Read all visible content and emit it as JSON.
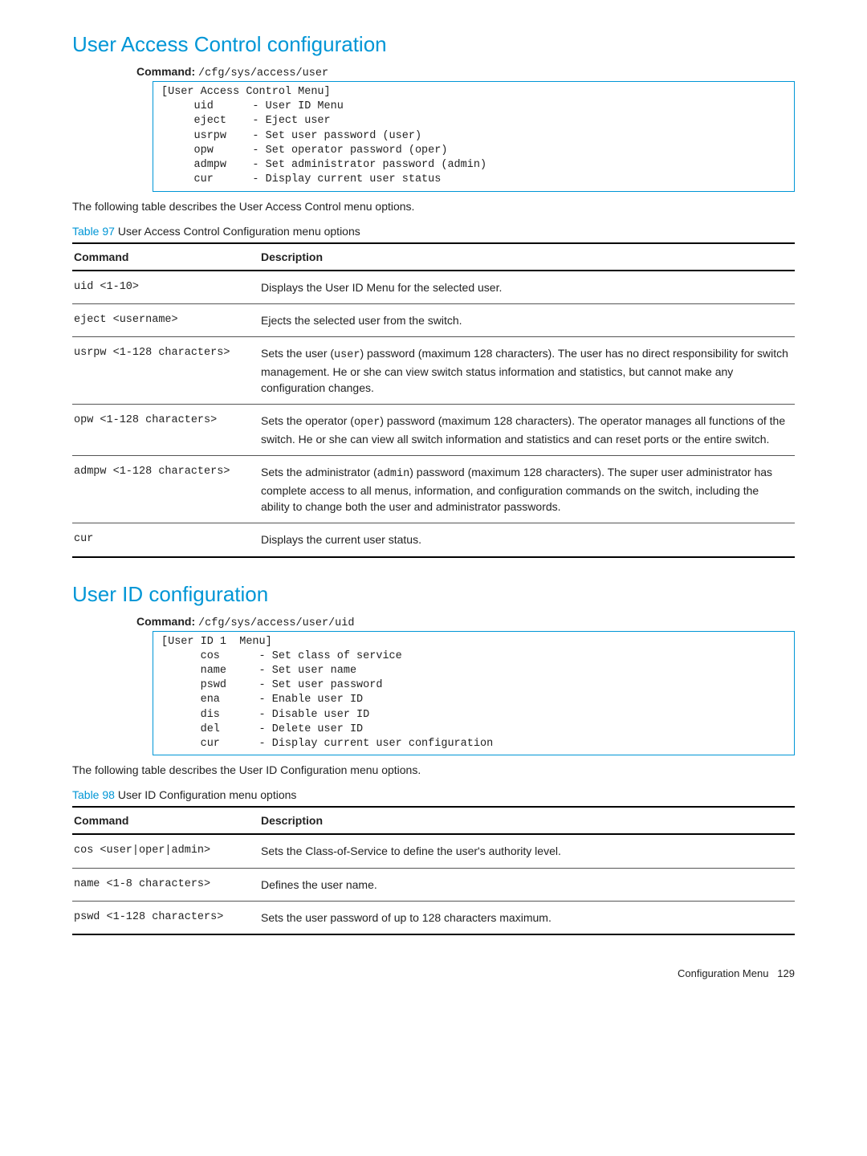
{
  "sections": {
    "uac": {
      "title": "User Access Control configuration",
      "commandLabel": "Command:",
      "commandPath": "/cfg/sys/access/user",
      "code": "[User Access Control Menu]\n     uid      - User ID Menu\n     eject    - Eject user\n     usrpw    - Set user password (user)\n     opw      - Set operator password (oper)\n     admpw    - Set administrator password (admin)\n     cur      - Display current user status",
      "intro": "The following table describes the User Access Control menu options.",
      "tableCaptionLabel": "Table 97",
      "tableCaptionText": "User Access Control Configuration menu options",
      "thCommand": "Command",
      "thDescription": "Description",
      "rows": [
        {
          "cmd": "uid <1-10>",
          "desc": "Displays the User ID Menu for the selected user."
        },
        {
          "cmd": "eject <username>",
          "desc": "Ejects the selected user from the switch."
        },
        {
          "cmd": "usrpw <1-128 characters>",
          "desc_pre": "Sets the user (",
          "desc_code": "user",
          "desc_post": ") password (maximum 128 characters). The user has no direct responsibility for switch management. He or she can view switch status information and statistics, but cannot make any configuration changes."
        },
        {
          "cmd": "opw <1-128 characters>",
          "desc_pre": "Sets the operator (",
          "desc_code": "oper",
          "desc_post": ")  password (maximum 128 characters). The operator manages all functions of the switch. He or she can view all switch information and statistics and can reset ports or the entire switch."
        },
        {
          "cmd": "admpw <1-128 characters>",
          "desc_pre": "Sets the administrator (",
          "desc_code": "admin",
          "desc_post": ") password (maximum 128 characters). The super user administrator has complete access to all menus, information, and configuration commands on the switch, including the ability to change both the user and administrator passwords."
        },
        {
          "cmd": "cur",
          "desc": "Displays the current user status."
        }
      ]
    },
    "uid": {
      "title": "User ID configuration",
      "commandLabel": "Command:",
      "commandPath": "/cfg/sys/access/user/uid",
      "code": "[User ID 1  Menu]\n      cos      - Set class of service\n      name     - Set user name\n      pswd     - Set user password\n      ena      - Enable user ID\n      dis      - Disable user ID\n      del      - Delete user ID\n      cur      - Display current user configuration",
      "intro": "The following table describes the User ID Configuration menu options.",
      "tableCaptionLabel": "Table 98",
      "tableCaptionText": "User ID Configuration menu options",
      "thCommand": "Command",
      "thDescription": "Description",
      "rows": [
        {
          "cmd": "cos <user|oper|admin>",
          "desc": "Sets the Class-of-Service to define the user's authority level."
        },
        {
          "cmd": "name <1-8 characters>",
          "desc": "Defines the user name."
        },
        {
          "cmd": "pswd <1-128 characters>",
          "desc": "Sets the user password of up to 128 characters maximum."
        }
      ]
    }
  },
  "footer": {
    "text": "Configuration Menu",
    "page": "129"
  }
}
